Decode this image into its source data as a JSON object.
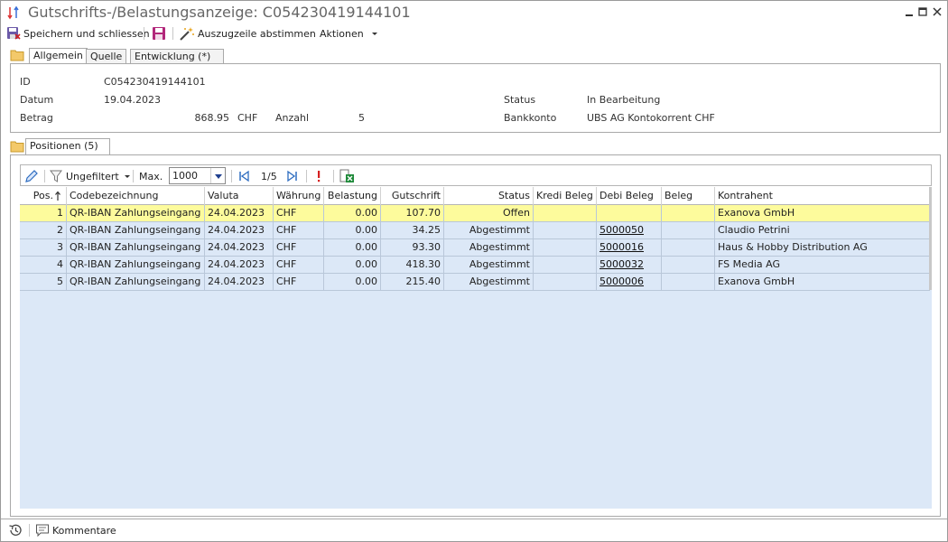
{
  "window": {
    "title": "Gutschrifts-/Belastungsanzeige: C054230419144101"
  },
  "toolbar": {
    "save_close_label": "Speichern und schliessen",
    "match_label": "Auszugzeile abstimmen",
    "actions_label": "Aktionen"
  },
  "tabs": [
    {
      "label": "Allgemein"
    },
    {
      "label": "Quelle"
    },
    {
      "label": "Entwicklung (*)"
    }
  ],
  "general": {
    "id_label": "ID",
    "id_value": "C054230419144101",
    "date_label": "Datum",
    "date_value": "19.04.2023",
    "amount_label": "Betrag",
    "amount_value": "868.95",
    "currency_value": "CHF",
    "count_label": "Anzahl",
    "count_value": "5",
    "status_label": "Status",
    "status_value": "In Bearbeitung",
    "account_label": "Bankkonto",
    "account_value": "UBS AG Kontokorrent CHF"
  },
  "positions": {
    "tab_label": "Positionen (5)",
    "filter_label": "Ungefiltert",
    "max_label": "Max.",
    "max_value": "1000",
    "page_label": "1/5",
    "columns": [
      "Pos.",
      "Codebezeichnung",
      "Valuta",
      "Währung",
      "Belastung",
      "Gutschrift",
      "Status",
      "Kredi Beleg",
      "Debi Beleg",
      "Beleg",
      "Kontrahent"
    ],
    "rows": [
      [
        "1",
        "QR-IBAN Zahlungseingang",
        "24.04.2023",
        "CHF",
        "0.00",
        "107.70",
        "Offen",
        "",
        "",
        "",
        "Exanova GmbH"
      ],
      [
        "2",
        "QR-IBAN Zahlungseingang",
        "24.04.2023",
        "CHF",
        "0.00",
        "34.25",
        "Abgestimmt",
        "",
        "5000050",
        "",
        "Claudio Petrini"
      ],
      [
        "3",
        "QR-IBAN Zahlungseingang",
        "24.04.2023",
        "CHF",
        "0.00",
        "93.30",
        "Abgestimmt",
        "",
        "5000016",
        "",
        "Haus & Hobby Distribution AG"
      ],
      [
        "4",
        "QR-IBAN Zahlungseingang",
        "24.04.2023",
        "CHF",
        "0.00",
        "418.30",
        "Abgestimmt",
        "",
        "5000032",
        "",
        "FS Media AG"
      ],
      [
        "5",
        "QR-IBAN Zahlungseingang",
        "24.04.2023",
        "CHF",
        "0.00",
        "215.40",
        "Abgestimmt",
        "",
        "5000006",
        "",
        "Exanova GmbH"
      ]
    ]
  },
  "footer": {
    "comments_label": "Kommentare"
  },
  "colors": {
    "selected_row": "#fdfb9c",
    "grid_background": "#dce8f7"
  }
}
